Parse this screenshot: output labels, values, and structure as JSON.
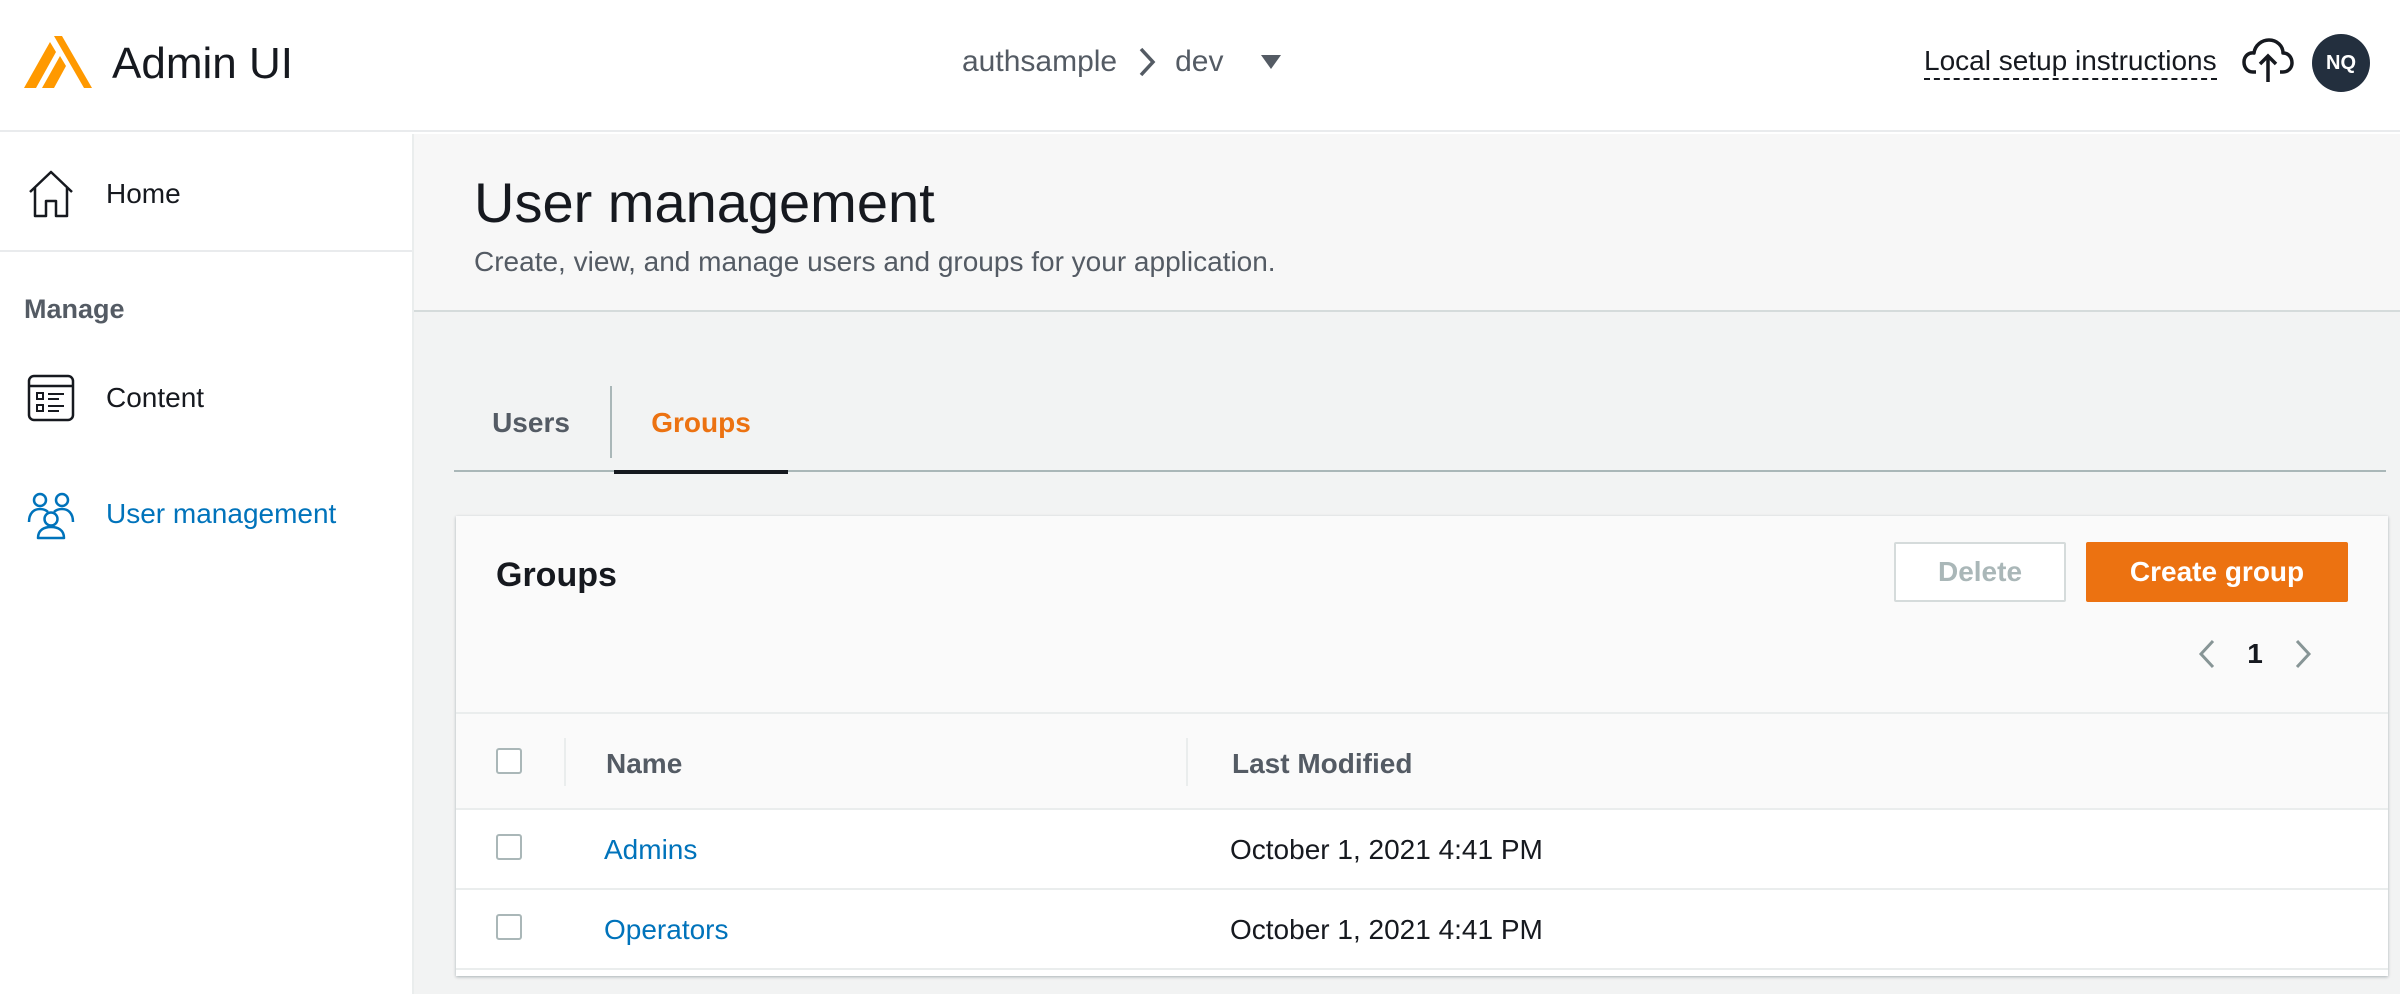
{
  "header": {
    "app_title": "Admin UI",
    "breadcrumb": {
      "app": "authsample",
      "env": "dev"
    },
    "setup_link": "Local setup instructions",
    "avatar_initials": "NQ",
    "brand_color": "#ff9900"
  },
  "sidebar": {
    "home_label": "Home",
    "section_label": "Manage",
    "items": [
      {
        "label": "Content",
        "icon": "content-icon"
      },
      {
        "label": "User management",
        "icon": "users-icon",
        "active": true
      }
    ]
  },
  "page": {
    "title": "User management",
    "description": "Create, view, and manage users and groups for your application."
  },
  "tabs": [
    {
      "label": "Users",
      "active": false
    },
    {
      "label": "Groups",
      "active": true
    }
  ],
  "groups_panel": {
    "title": "Groups",
    "delete_label": "Delete",
    "create_label": "Create group",
    "current_page": "1",
    "columns": [
      "Name",
      "Last Modified"
    ],
    "rows": [
      {
        "name": "Admins",
        "last_modified": "October 1, 2021 4:41 PM"
      },
      {
        "name": "Operators",
        "last_modified": "October 1, 2021 4:41 PM"
      }
    ]
  },
  "colors": {
    "accent": "#ec7211",
    "link": "#0073bb",
    "avatar_bg": "#232f3e"
  }
}
